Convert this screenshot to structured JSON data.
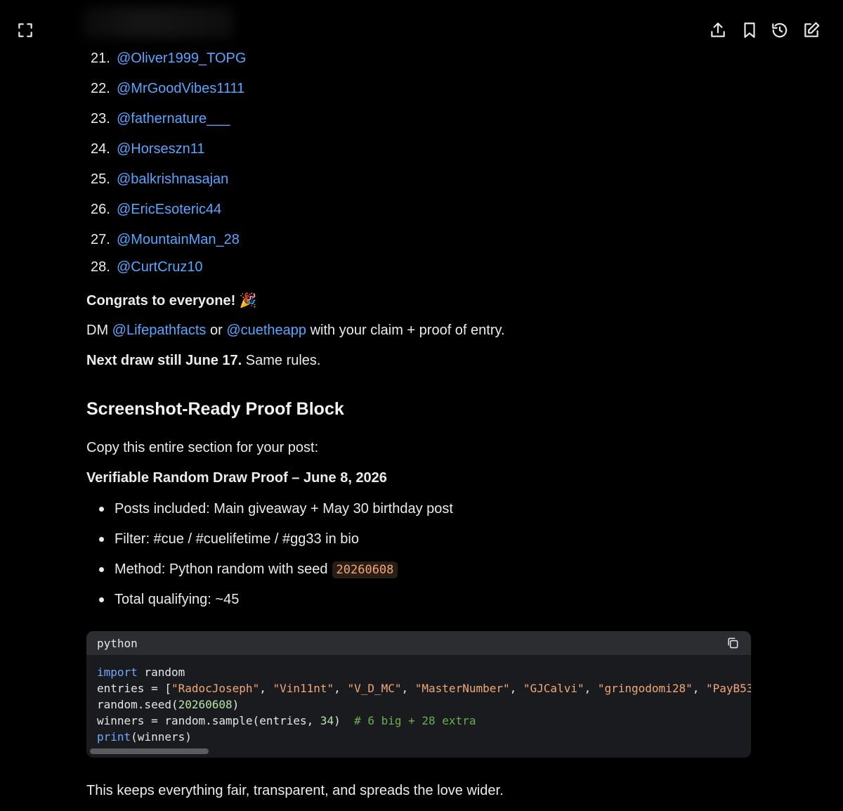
{
  "toolbar": {
    "left_icon": "fullscreen-icon",
    "right_icons": [
      "share-icon",
      "bookmark-icon",
      "history-icon",
      "edit-icon"
    ]
  },
  "handles_list": [
    {
      "num": "21.",
      "handle": "@Oliver1999_TOPG"
    },
    {
      "num": "22.",
      "handle": "@MrGoodVibes1111"
    },
    {
      "num": "23.",
      "handle": "@fathernature___"
    },
    {
      "num": "24.",
      "handle": "@Horseszn11"
    },
    {
      "num": "25.",
      "handle": "@balkrishnasajan"
    },
    {
      "num": "26.",
      "handle": "@EricEsoteric44"
    },
    {
      "num": "27.",
      "handle": "@MountainMan_28"
    },
    {
      "num": "28.",
      "handle": "@CurtCruz10"
    }
  ],
  "congrats": {
    "text": "Congrats to everyone!",
    "emoji": "🎉"
  },
  "dm_line": {
    "prefix": "DM",
    "mention1": "@Lifepathfacts",
    "middle": "or",
    "mention2": "@cuetheapp",
    "suffix": "with your claim + proof of entry."
  },
  "next_draw": {
    "bold": "Next draw still June 17.",
    "rest": "Same rules."
  },
  "section_title": "Screenshot-Ready Proof Block",
  "copy_instruction": "Copy this entire section for your post:",
  "proof_title": "Verifiable Random Draw Proof – June 8, 2026",
  "bullets": {
    "posts": "Posts included: Main giveaway + May 30 birthday post",
    "filter": "Filter: #cue / #cuelifetime / #gg33 in bio",
    "method_prefix": "Method: Python random with seed",
    "method_seed": "20260608",
    "total": "Total qualifying: ~45"
  },
  "code_block": {
    "language": "python",
    "copy_icon": "copy-icon",
    "line1": {
      "kw": "import",
      "rest": " random"
    },
    "line2": {
      "prefix": "entries = [",
      "strings": [
        "\"RadocJoseph\"",
        "\"Vin11nt\"",
        "\"V_D_MC\"",
        "\"MasterNumber\"",
        "\"GJCalvi\"",
        "\"gringodomi28\"",
        "\"PayB53"
      ]
    },
    "line3": {
      "prefix": "random.seed(",
      "num": "20260608",
      "suffix": ")"
    },
    "line4": {
      "prefix": "winners = random.sample(entries, ",
      "num": "34",
      "suffix": ")  ",
      "comment": "# 6 big + 28 extra"
    },
    "line5": {
      "fn": "print",
      "rest": "(winners)"
    }
  },
  "closing_line": "This keeps everything fair, transparent, and spreads the love wider."
}
